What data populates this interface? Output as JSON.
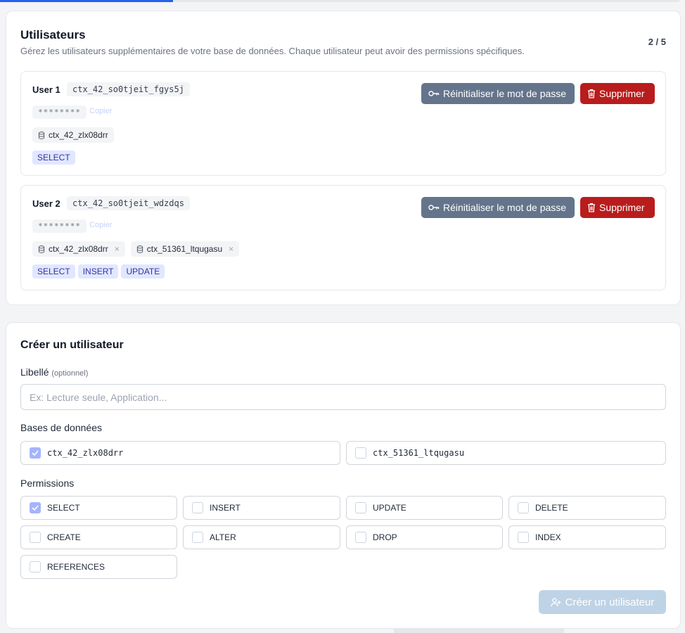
{
  "progress": {
    "value_fraction": 0.255
  },
  "users_section": {
    "title": "Utilisateurs",
    "subtitle": "Gérez les utilisateurs supplémentaires de votre base de données. Chaque utilisateur peut avoir des permissions spécifiques.",
    "counter": "2 / 5",
    "users": [
      {
        "label": "User 1",
        "login": "ctx_42_so0tjeit_fgys5j",
        "password_mask": "********",
        "copy_label": "Copier",
        "databases": [
          "ctx_42_zlx08drr"
        ],
        "permissions": [
          "SELECT"
        ],
        "reset_label": "Réinitialiser le mot de passe",
        "delete_label": "Supprimer"
      },
      {
        "label": "User 2",
        "login": "ctx_42_so0tjeit_wdzdqs",
        "password_mask": "********",
        "copy_label": "Copier",
        "databases": [
          "ctx_42_zlx08drr",
          "ctx_51361_ltqugasu"
        ],
        "remove_glyph": "×",
        "permissions": [
          "SELECT",
          "INSERT",
          "UPDATE"
        ],
        "reset_label": "Réinitialiser le mot de passe",
        "delete_label": "Supprimer"
      }
    ]
  },
  "create_section": {
    "title": "Créer un utilisateur",
    "label_field": {
      "label": "Libellé",
      "hint": "(optionnel)",
      "placeholder": "Ex: Lecture seule, Application...",
      "value": ""
    },
    "databases_label": "Bases de données",
    "databases": [
      {
        "name": "ctx_42_zlx08drr",
        "checked": true
      },
      {
        "name": "ctx_51361_ltqugasu",
        "checked": false
      }
    ],
    "permissions_label": "Permissions",
    "permissions": [
      {
        "name": "SELECT",
        "checked": true
      },
      {
        "name": "INSERT",
        "checked": false
      },
      {
        "name": "UPDATE",
        "checked": false
      },
      {
        "name": "DELETE",
        "checked": false
      },
      {
        "name": "CREATE",
        "checked": false
      },
      {
        "name": "ALTER",
        "checked": false
      },
      {
        "name": "DROP",
        "checked": false
      },
      {
        "name": "INDEX",
        "checked": false
      },
      {
        "name": "REFERENCES",
        "checked": false
      }
    ],
    "submit_label": "Créer un utilisateur"
  },
  "colors": {
    "accent": "#2563eb",
    "reset_button": "#64748b",
    "delete_button": "#b91c1c",
    "permission_tag_bg": "#e0e7ff",
    "permission_tag_text": "#3730a3",
    "checkbox_checked": "#a5b4fc",
    "submit_disabled": "#bfd3e6"
  },
  "icons": {
    "reset": "key-icon",
    "delete": "trash-icon",
    "database": "database-icon",
    "create": "user-plus-icon",
    "check": "check-icon"
  }
}
